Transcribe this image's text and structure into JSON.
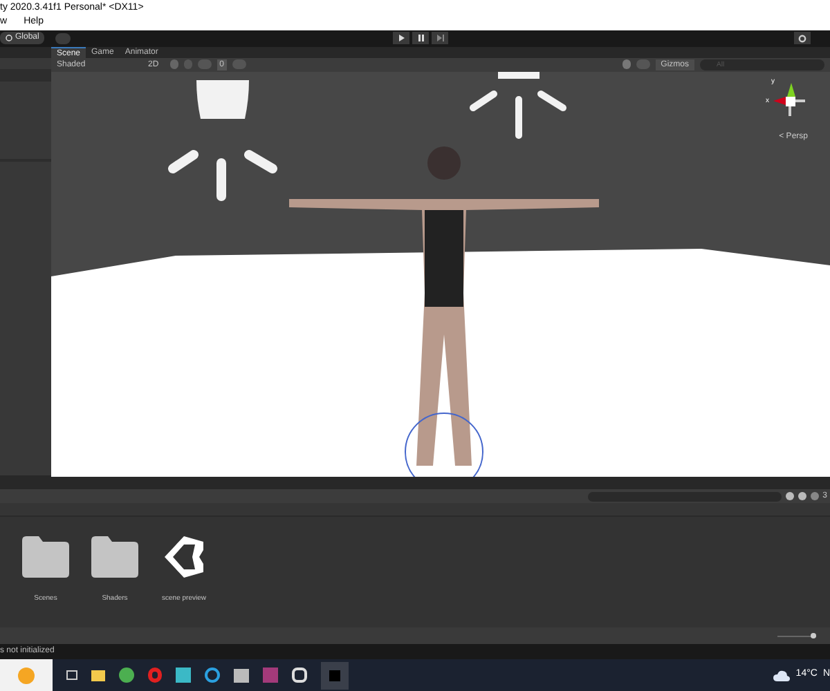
{
  "title_bar": {
    "title": "ty 2020.3.41f1 Personal* <DX11>"
  },
  "menu": [
    "w",
    "Help"
  ],
  "toolbar": {
    "global_button": "Global"
  },
  "scene_tabs": [
    {
      "label": "Scene",
      "selected": true
    },
    {
      "label": "Game",
      "selected": false
    },
    {
      "label": "Animator",
      "selected": false
    }
  ],
  "scene_toolbar": {
    "draw_mode": "Shaded",
    "view_2d": "2D",
    "hidden_count": "0",
    "gizmos": "Gizmos",
    "search_placeholder": "All"
  },
  "gizmo": {
    "x_label": "x",
    "y_label": "y",
    "projection": "< Persp"
  },
  "project": {
    "hidden_count": "3",
    "assets": [
      {
        "name": "Scenes",
        "kind": "folder"
      },
      {
        "name": "Shaders",
        "kind": "folder"
      },
      {
        "name": "scene preview",
        "kind": "unity"
      }
    ],
    "zoom_slider": {
      "level": 0.93
    }
  },
  "status": "s not initialized",
  "taskbar": {
    "temperature": "14°C",
    "trailing": "N"
  }
}
